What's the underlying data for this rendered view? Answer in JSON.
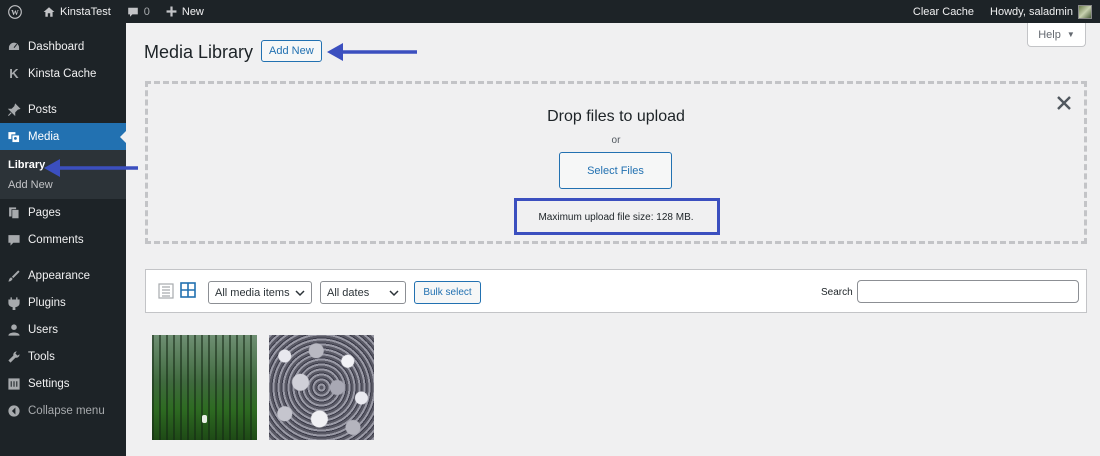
{
  "adminbar": {
    "site_name": "KinstaTest",
    "comments_count": "0",
    "new_label": "New",
    "clear_cache": "Clear Cache",
    "howdy": "Howdy, saladmin"
  },
  "sidebar": {
    "items": [
      {
        "label": "Dashboard",
        "icon": "dashboard-icon"
      },
      {
        "label": "Kinsta Cache",
        "icon": "kinsta-icon"
      },
      {
        "label": "Posts",
        "icon": "pin-icon"
      },
      {
        "label": "Media",
        "icon": "media-icon"
      },
      {
        "label": "Pages",
        "icon": "pages-icon"
      },
      {
        "label": "Comments",
        "icon": "comment-icon"
      },
      {
        "label": "Appearance",
        "icon": "brush-icon"
      },
      {
        "label": "Plugins",
        "icon": "plugin-icon"
      },
      {
        "label": "Users",
        "icon": "user-icon"
      },
      {
        "label": "Tools",
        "icon": "wrench-icon"
      },
      {
        "label": "Settings",
        "icon": "settings-icon"
      },
      {
        "label": "Collapse menu",
        "icon": "collapse-icon"
      }
    ],
    "media_submenu": [
      "Library",
      "Add New"
    ]
  },
  "main": {
    "title": "Media Library",
    "add_new": "Add New",
    "help": "Help"
  },
  "uploader": {
    "title": "Drop files to upload",
    "or": "or",
    "select_files": "Select Files",
    "max_size": "Maximum upload file size: 128 MB."
  },
  "toolbar": {
    "media_type": "All media items",
    "dates": "All dates",
    "bulk_select": "Bulk select",
    "search_label": "Search",
    "search_value": ""
  },
  "colors": {
    "admin_dark": "#1d2327",
    "accent": "#2271b1",
    "annotation": "#3b4fbf"
  }
}
